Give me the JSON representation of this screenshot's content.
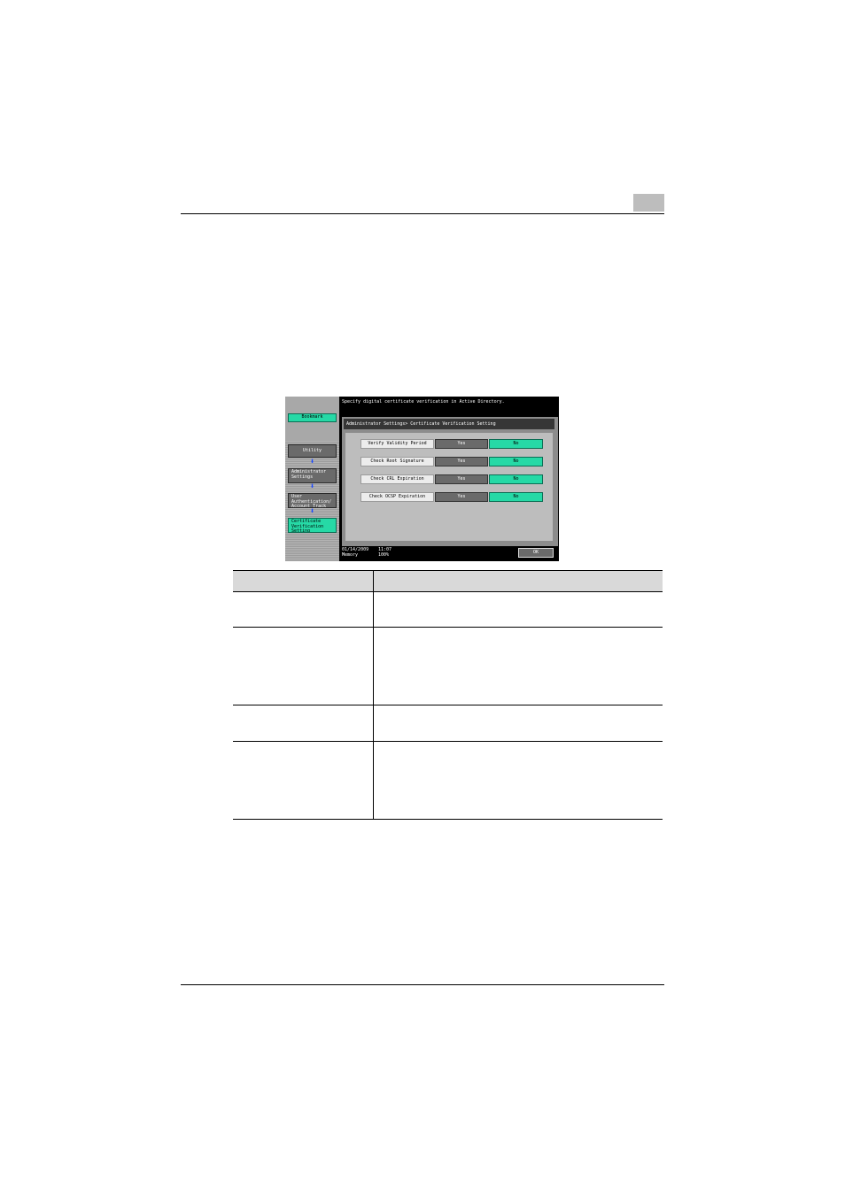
{
  "panel": {
    "message": "Specify digital certificate verification in Active Directory.",
    "sidebar": {
      "bookmark_label": "Bookmark",
      "items": [
        {
          "label": "Utility"
        },
        {
          "label": "Administrator Settings"
        },
        {
          "label": "User Authentication/ Account Track"
        },
        {
          "label": "Certificate Verification Setting"
        }
      ]
    },
    "breadcrumb": "Administrator Settings> Certificate Verification Setting",
    "settings": [
      {
        "label": "Verify Validity Period",
        "yes": "Yes",
        "no": "No",
        "selected": "No"
      },
      {
        "label": "Check Root Signature",
        "yes": "Yes",
        "no": "No",
        "selected": "No"
      },
      {
        "label": "Check CRL Expiration",
        "yes": "Yes",
        "no": "No",
        "selected": "No"
      },
      {
        "label": "Check OCSP Expiration",
        "yes": "Yes",
        "no": "No",
        "selected": "No"
      }
    ],
    "status": {
      "date": "01/14/2009",
      "time": "11:07",
      "memory_label": "Memory",
      "memory_value": "100%"
    },
    "ok_label": "OK"
  },
  "colors": {
    "selected": "#26d9a6",
    "unselected": "#6a6a6a",
    "tab": "#bdbdbd"
  }
}
